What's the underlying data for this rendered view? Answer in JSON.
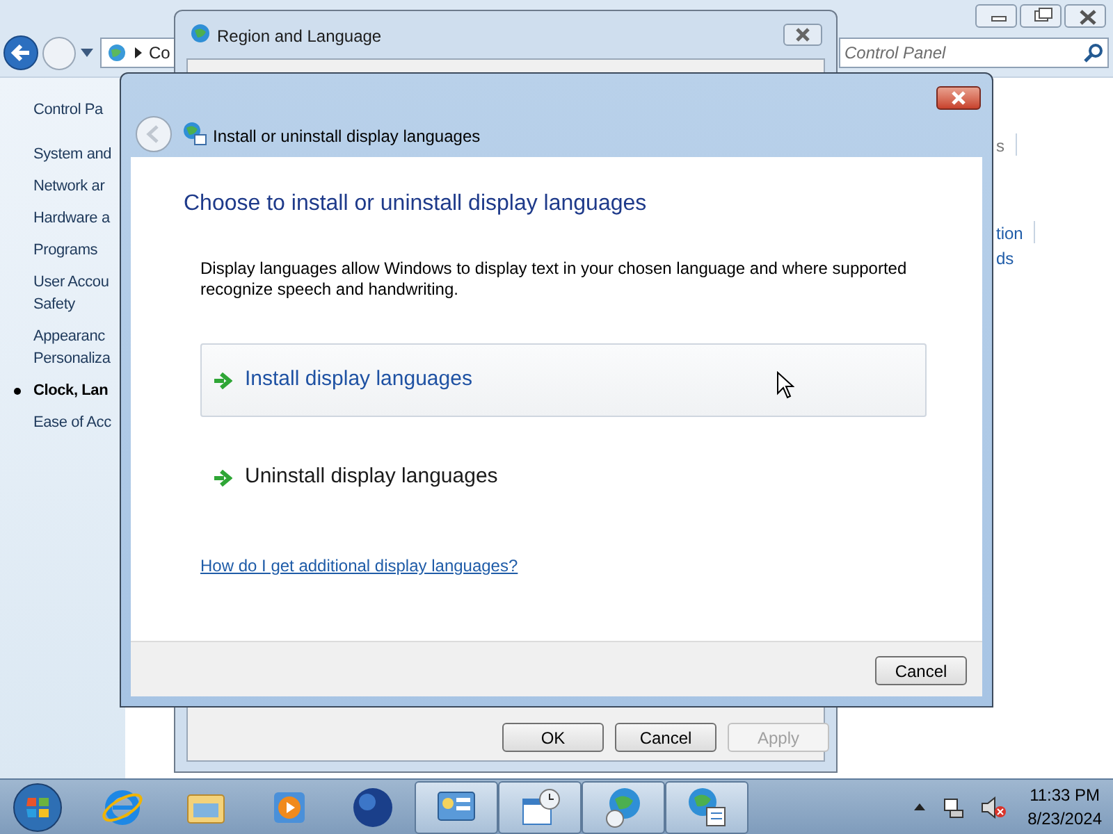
{
  "control_panel": {
    "address": "Co",
    "search_placeholder": "Control Panel",
    "sidebar": [
      {
        "lines": [
          "Control Pa"
        ],
        "selected": false
      },
      {
        "lines": [
          "System and"
        ],
        "selected": false
      },
      {
        "lines": [
          "Network ar"
        ],
        "selected": false
      },
      {
        "lines": [
          "Hardware a"
        ],
        "selected": false
      },
      {
        "lines": [
          "Programs"
        ],
        "selected": false
      },
      {
        "lines": [
          "User Accou",
          "Safety"
        ],
        "selected": false
      },
      {
        "lines": [
          "Appearanc",
          "Personaliza"
        ],
        "selected": false
      },
      {
        "lines": [
          "Clock, Lan"
        ],
        "selected": true
      },
      {
        "lines": [
          "Ease of Acc"
        ],
        "selected": false
      }
    ],
    "fragments": [
      "s",
      "tion",
      "ds"
    ]
  },
  "region_window": {
    "title": "Region and Language",
    "buttons": [
      {
        "label": "OK",
        "disabled": false
      },
      {
        "label": "Cancel",
        "disabled": false
      },
      {
        "label": "Apply",
        "disabled": true
      }
    ]
  },
  "dialog": {
    "title": "Install or uninstall display languages",
    "heading": "Choose to install or uninstall display languages",
    "description": "Display languages allow Windows to display text in your chosen language and where supported recognize speech and handwriting.",
    "options": [
      {
        "label": "Install display languages",
        "selected": true
      },
      {
        "label": "Uninstall display languages",
        "selected": false
      }
    ],
    "link": "How do I get additional display languages?",
    "cancel": "Cancel"
  },
  "taskbar": {
    "icons": [
      {
        "kind": "browser",
        "running": false
      },
      {
        "kind": "folder",
        "running": false
      },
      {
        "kind": "media",
        "running": false
      },
      {
        "kind": "sphere",
        "running": false
      },
      {
        "kind": "panel",
        "running": true
      },
      {
        "kind": "calendar",
        "running": true
      },
      {
        "kind": "globe-clock",
        "running": true
      },
      {
        "kind": "globe-list",
        "running": true
      }
    ],
    "time": "11:33 PM",
    "date": "8/23/2024"
  }
}
